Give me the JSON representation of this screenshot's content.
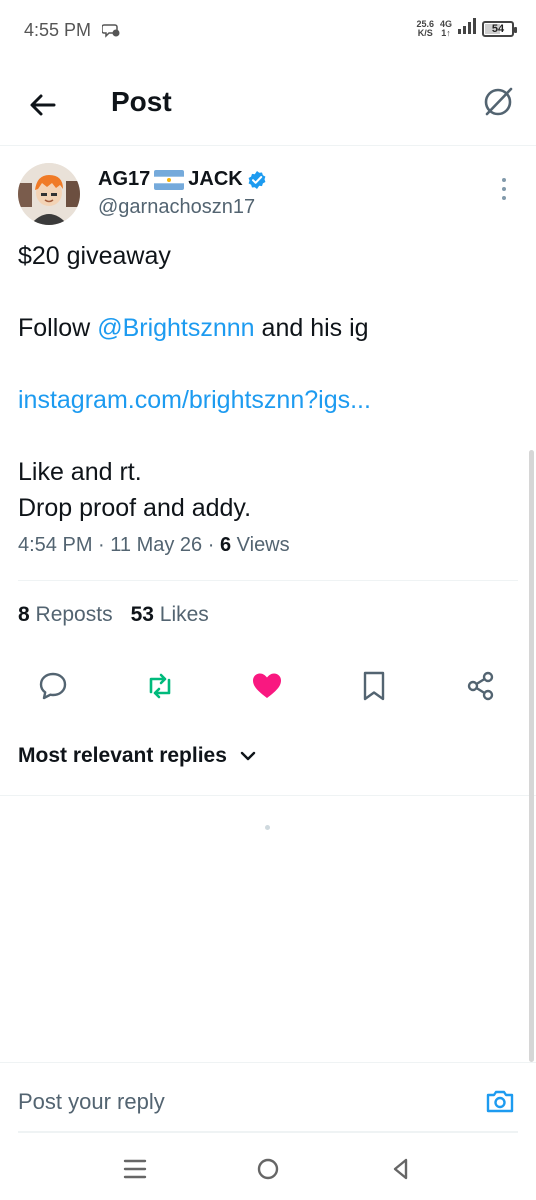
{
  "status_bar": {
    "time": "4:55 PM",
    "notification_icon": "message-icon",
    "net_speed_value": "25.6",
    "net_speed_unit": "K/S",
    "network_type": "4G",
    "network_sub": "1↑",
    "battery_level": "54",
    "battery_fraction": 0.54
  },
  "header": {
    "title": "Post",
    "back_icon": "arrow-left-icon",
    "grok_icon": "grok-icon"
  },
  "post": {
    "author_name": "AG17",
    "author_name_suffix": "JACK",
    "flag_icon": "argentina-flag-icon",
    "verified_icon": "verified-badge-icon",
    "handle": "@garnachoszn17",
    "lines": {
      "line1": "$20 giveaway",
      "line2_pre": "Follow ",
      "line2_mention": "@Brightsznnn",
      "line2_post": " and his ig",
      "line3_link": "instagram.com/brightsznn?igs...",
      "line4": "Like and rt.",
      "line5": "Drop proof and addy."
    },
    "time": "4:54 PM",
    "date": "11 May 26",
    "views_count": "6",
    "views_label": "Views",
    "reposts_count": "8",
    "reposts_label": "Reposts",
    "likes_count": "53",
    "likes_label": "Likes",
    "colors": {
      "accent": "#1d9bf0",
      "repost": "#00ba7c",
      "like": "#f91880"
    }
  },
  "replies": {
    "sort_label": "Most relevant replies"
  },
  "reply_bar": {
    "placeholder": "Post your reply"
  }
}
